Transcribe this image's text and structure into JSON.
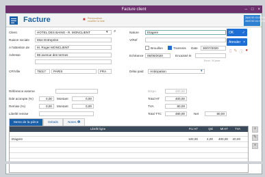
{
  "window": {
    "title": "Facture client"
  },
  "header": {
    "title": "Facture",
    "flag": "Prévisualiser\nmodifier la liste",
    "stamp": "26/07/20 15:20 EN\n26/07/20 15:17 EN"
  },
  "left": {
    "client_label": "Client",
    "client": "HOTEL DES BAINS - R. MONCLIENT",
    "raison_label": "Raison sociale",
    "raison": "Mon Entreprise",
    "attention_label": "A l'attention de",
    "attention": "M. Roger MONCLIENT",
    "adresse_label": "Adresse",
    "adresse": "88 avenue des termes",
    "cp_label": "CP/Ville",
    "cp": "75017",
    "ville": "PARIS",
    "pays": "FRA",
    "ref_label": "Référence externe",
    "acompte_label": "Dde acompte (%)",
    "acompte_pct": "0,00",
    "acompte_montant_label": "Montant",
    "acompte_montant": "0,00",
    "remise_label": "Remise (%)",
    "remise_pct": "0,00",
    "remise_montant_label": "Montant",
    "remise_montant": "0,00",
    "libelle_label": "Libellé remise"
  },
  "right": {
    "nature_label": "Nature",
    "nature": "Etagere",
    "vref_label": "V/Ref",
    "brouillon_label": "Brouillon",
    "transmis_label": "Transmis",
    "date_label": "Date",
    "date": "30/07/2020",
    "echeance_label": "Echéance",
    "echeance": "06/08/2020",
    "encaisse_label": "Encaissé le",
    "encaisse_hint": "Envoi : 90 jours",
    "delai_label": "Délai paid",
    "delai": "Anticipation",
    "dispo_label": "Dispo",
    "dispo": "400,00",
    "total_ht_label": "Total HT",
    "total_ht": "400,00",
    "tva_label": "TVA",
    "tva": "80,00",
    "total_ttc_label": "Total TTC",
    "total_ttc": "480,00",
    "net_label": "Net",
    "net": "80,00"
  },
  "actions": {
    "ok": "OK",
    "cancel": "Annuler"
  },
  "tabs": [
    {
      "label": "Items de la pièce"
    },
    {
      "label": "Détails"
    },
    {
      "label": "Notes"
    }
  ],
  "grid": {
    "headers": [
      "Libellé ligne",
      "P.U HT",
      "Qté",
      "Mt HT",
      "TVA"
    ],
    "rows": [
      {
        "libelle": "Etagere",
        "pu": "100,00",
        "qte": "4,00",
        "mt": "400,00",
        "tva": "20,00"
      }
    ]
  }
}
